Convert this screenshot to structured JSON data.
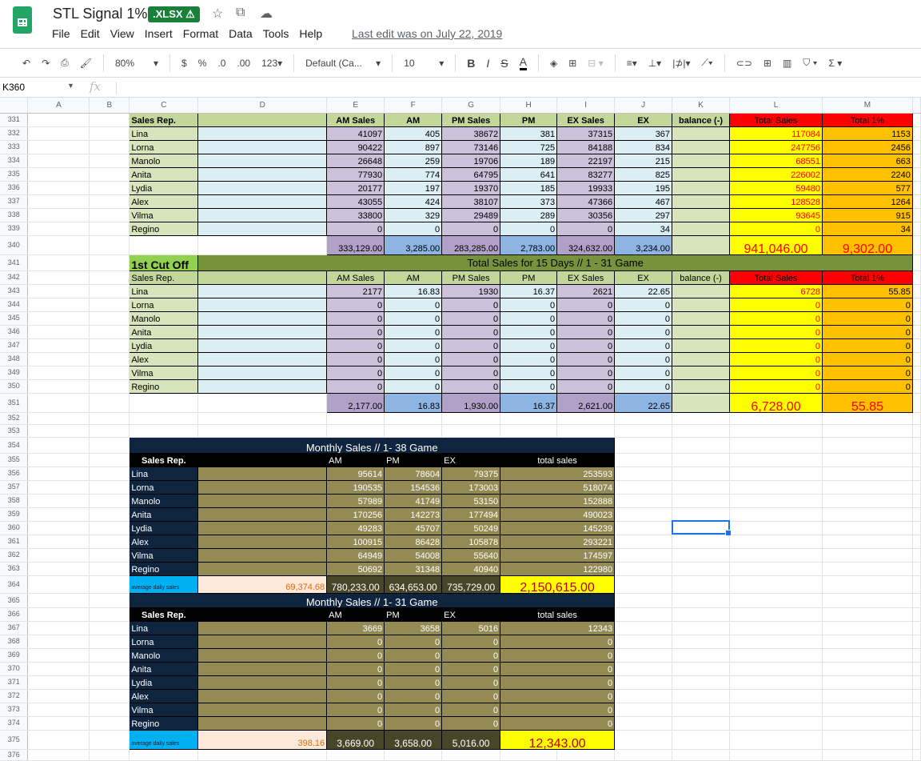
{
  "app": {
    "title": "STL Signal 1%",
    "badge": ".XLSX ⚠",
    "last_edit": "Last edit was on July 22, 2019",
    "menu": [
      "File",
      "Edit",
      "View",
      "Insert",
      "Format",
      "Data",
      "Tools",
      "Help"
    ]
  },
  "toolbar": {
    "zoom": "80%",
    "currency": "$",
    "percent": "%",
    "dec_less": ".0",
    "dec_more": ".00",
    "format": "123▾",
    "font": "Default (Ca...",
    "font_size": "10",
    "bold": "B",
    "italic": "I",
    "strike": "S",
    "text_color": "A"
  },
  "formula_bar": {
    "cell_ref": "K360",
    "fx": "fx",
    "value": ""
  },
  "columns": [
    "A",
    "B",
    "C",
    "D",
    "E",
    "F",
    "G",
    "H",
    "I",
    "J",
    "K",
    "L",
    "M"
  ],
  "row_numbers": [
    331,
    332,
    333,
    334,
    335,
    336,
    337,
    338,
    339,
    340,
    341,
    342,
    343,
    344,
    345,
    346,
    347,
    348,
    349,
    350,
    351,
    352,
    353,
    354,
    355,
    356,
    357,
    358,
    359,
    360,
    361,
    362,
    363,
    364,
    365,
    366,
    367,
    368,
    369,
    370,
    371,
    372,
    373,
    374,
    375,
    376
  ],
  "top_table": {
    "headers": [
      "Sales Rep.",
      "AM Sales",
      "AM",
      "PM Sales",
      "PM",
      "EX Sales",
      "EX",
      "balance (-)",
      "Total Sales",
      "Total 1%"
    ],
    "rows": [
      {
        "name": "Lina",
        "v": [
          "41097",
          "405",
          "38672",
          "381",
          "37315",
          "367"
        ],
        "total": "117084",
        "pct": "1153"
      },
      {
        "name": "Lorna",
        "v": [
          "90422",
          "897",
          "73146",
          "725",
          "84188",
          "834"
        ],
        "total": "247756",
        "pct": "2456"
      },
      {
        "name": "Manolo",
        "v": [
          "26648",
          "259",
          "19706",
          "189",
          "22197",
          "215"
        ],
        "total": "68551",
        "pct": "663"
      },
      {
        "name": "Anita",
        "v": [
          "77930",
          "774",
          "64795",
          "641",
          "83277",
          "825"
        ],
        "total": "226002",
        "pct": "2240"
      },
      {
        "name": "Lydia",
        "v": [
          "20177",
          "197",
          "19370",
          "185",
          "19933",
          "195"
        ],
        "total": "59480",
        "pct": "577"
      },
      {
        "name": "Alex",
        "v": [
          "43055",
          "424",
          "38107",
          "373",
          "47366",
          "467"
        ],
        "total": "128528",
        "pct": "1264"
      },
      {
        "name": "Vilma",
        "v": [
          "33800",
          "329",
          "29489",
          "289",
          "30356",
          "297"
        ],
        "total": "93645",
        "pct": "915"
      },
      {
        "name": "Regino",
        "v": [
          "0",
          "0",
          "0",
          "0",
          "0",
          "34"
        ],
        "total": "0",
        "pct": "34"
      }
    ],
    "totals": {
      "v": [
        "333,129.00",
        "3,285.00",
        "283,285.00",
        "2,783.00",
        "324,632.00",
        "3,234.00"
      ],
      "total": "941,046.00",
      "pct": "9,302.00"
    }
  },
  "cutoff_table": {
    "label": "1st Cut Off",
    "banner": "Total Sales for 15 Days // 1 - 31 Game",
    "headers": [
      "Sales Rep.",
      "AM Sales",
      "AM",
      "PM Sales",
      "PM",
      "EX Sales",
      "EX",
      "balance (-)",
      "Total Sales",
      "Total 1%"
    ],
    "rows": [
      {
        "name": "Lina",
        "v": [
          "2177",
          "16.83",
          "1930",
          "16.37",
          "2621",
          "22.65"
        ],
        "total": "6728",
        "pct": "55.85"
      },
      {
        "name": "Lorna",
        "v": [
          "0",
          "0",
          "0",
          "0",
          "0",
          "0"
        ],
        "total": "0",
        "pct": "0"
      },
      {
        "name": "Manolo",
        "v": [
          "0",
          "0",
          "0",
          "0",
          "0",
          "0"
        ],
        "total": "0",
        "pct": "0"
      },
      {
        "name": "Anita",
        "v": [
          "0",
          "0",
          "0",
          "0",
          "0",
          "0"
        ],
        "total": "0",
        "pct": "0"
      },
      {
        "name": "Lydia",
        "v": [
          "0",
          "0",
          "0",
          "0",
          "0",
          "0"
        ],
        "total": "0",
        "pct": "0"
      },
      {
        "name": "Alex",
        "v": [
          "0",
          "0",
          "0",
          "0",
          "0",
          "0"
        ],
        "total": "0",
        "pct": "0"
      },
      {
        "name": "Vilma",
        "v": [
          "0",
          "0",
          "0",
          "0",
          "0",
          "0"
        ],
        "total": "0",
        "pct": "0"
      },
      {
        "name": "Regino",
        "v": [
          "0",
          "0",
          "0",
          "0",
          "0",
          "0"
        ],
        "total": "0",
        "pct": "0"
      }
    ],
    "totals": {
      "v": [
        "2,177.00",
        "16.83",
        "1,930.00",
        "16.37",
        "2,621.00",
        "22.65"
      ],
      "total": "6,728.00",
      "pct": "55.85"
    }
  },
  "monthly_38": {
    "title": "Monthly Sales // 1- 38 Game",
    "headers": [
      "Sales Rep.",
      "AM",
      "PM",
      "EX",
      "total sales"
    ],
    "rows": [
      {
        "name": "Lina",
        "v": [
          "95614",
          "78604",
          "79375",
          "253593"
        ]
      },
      {
        "name": "Lorna",
        "v": [
          "190535",
          "154536",
          "173003",
          "518074"
        ]
      },
      {
        "name": "Manolo",
        "v": [
          "57989",
          "41749",
          "53150",
          "152888"
        ]
      },
      {
        "name": "Anita",
        "v": [
          "170256",
          "142273",
          "177494",
          "490023"
        ]
      },
      {
        "name": "Lydia",
        "v": [
          "49283",
          "45707",
          "50249",
          "145239"
        ]
      },
      {
        "name": "Alex",
        "v": [
          "100915",
          "86428",
          "105878",
          "293221"
        ]
      },
      {
        "name": "Vilma",
        "v": [
          "64949",
          "54008",
          "55640",
          "174597"
        ]
      },
      {
        "name": "Regino",
        "v": [
          "50692",
          "31348",
          "40940",
          "122980"
        ]
      }
    ],
    "footer": {
      "label": "average daily sales",
      "avg": "69,374.68",
      "v": [
        "780,233.00",
        "634,653.00",
        "735,729.00",
        "2,150,615.00"
      ]
    }
  },
  "monthly_31": {
    "title": "Monthly Sales // 1- 31 Game",
    "headers": [
      "Sales Rep.",
      "AM",
      "PM",
      "EX",
      "total sales"
    ],
    "rows": [
      {
        "name": "Lina",
        "v": [
          "3669",
          "3658",
          "5016",
          "12343"
        ]
      },
      {
        "name": "Lorna",
        "v": [
          "0",
          "0",
          "0",
          "0"
        ]
      },
      {
        "name": "Manolo",
        "v": [
          "0",
          "0",
          "0",
          "0"
        ]
      },
      {
        "name": "Anita",
        "v": [
          "0",
          "0",
          "0",
          "0"
        ]
      },
      {
        "name": "Lydia",
        "v": [
          "0",
          "0",
          "0",
          "0"
        ]
      },
      {
        "name": "Alex",
        "v": [
          "0",
          "0",
          "0",
          "0"
        ]
      },
      {
        "name": "Vilma",
        "v": [
          "0",
          "0",
          "0",
          "0"
        ]
      },
      {
        "name": "Regino",
        "v": [
          "0",
          "0",
          "0",
          "0"
        ]
      }
    ],
    "footer": {
      "label": "average daily sales",
      "avg": "398.16",
      "v": [
        "3,669.00",
        "3,658.00",
        "5,016.00",
        "12,343.00"
      ]
    }
  }
}
